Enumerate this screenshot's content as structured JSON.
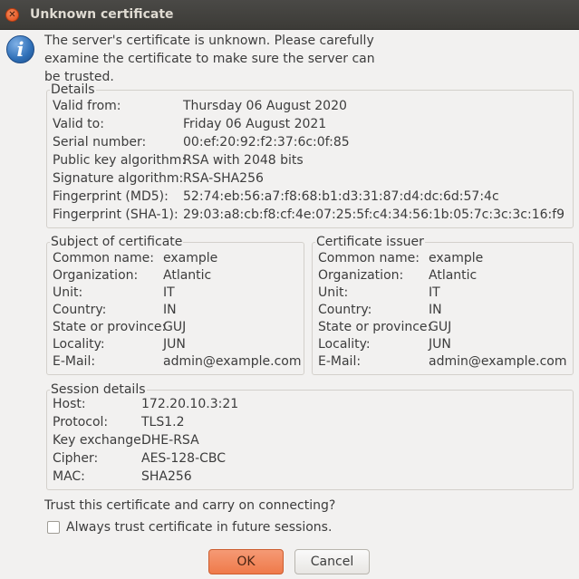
{
  "window": {
    "title": "Unknown certificate",
    "close_glyph": "✕"
  },
  "message": "The server's certificate is unknown. Please carefully examine the certificate to make sure the server can be trusted.",
  "details": {
    "label": "Details",
    "rows": [
      {
        "key": "Valid from:",
        "value": "Thursday 06 August 2020"
      },
      {
        "key": "Valid to:",
        "value": "Friday 06 August 2021"
      },
      {
        "key": "Serial number:",
        "value": "00:ef:20:92:f2:37:6c:0f:85"
      },
      {
        "key": "Public key algorithm:",
        "value": "RSA with 2048 bits"
      },
      {
        "key": "Signature algorithm:",
        "value": "RSA-SHA256"
      },
      {
        "key": "Fingerprint (MD5):",
        "value": "52:74:eb:56:a7:f8:68:b1:d3:31:87:d4:dc:6d:57:4c"
      },
      {
        "key": "Fingerprint (SHA-1):",
        "value": "29:03:a8:cb:f8:cf:4e:07:25:5f:c4:34:56:1b:05:7c:3c:3c:16:f9"
      }
    ]
  },
  "subject": {
    "label": "Subject of certificate",
    "rows": [
      {
        "key": "Common name:",
        "value": "example"
      },
      {
        "key": "Organization:",
        "value": "Atlantic"
      },
      {
        "key": "Unit:",
        "value": "IT"
      },
      {
        "key": "Country:",
        "value": "IN"
      },
      {
        "key": "State or province:",
        "value": "GUJ"
      },
      {
        "key": "Locality:",
        "value": "JUN"
      },
      {
        "key": "E-Mail:",
        "value": "admin@example.com"
      }
    ]
  },
  "issuer": {
    "label": "Certificate issuer",
    "rows": [
      {
        "key": "Common name:",
        "value": "example"
      },
      {
        "key": "Organization:",
        "value": "Atlantic"
      },
      {
        "key": "Unit:",
        "value": "IT"
      },
      {
        "key": "Country:",
        "value": "IN"
      },
      {
        "key": "State or province:",
        "value": "GUJ"
      },
      {
        "key": "Locality:",
        "value": "JUN"
      },
      {
        "key": "E-Mail:",
        "value": "admin@example.com"
      }
    ]
  },
  "session": {
    "label": "Session details",
    "rows": [
      {
        "key": "Host:",
        "value": "172.20.10.3:21"
      },
      {
        "key": "Protocol:",
        "value": "TLS1.2"
      },
      {
        "key": "Key exchange:",
        "value": "DHE-RSA"
      },
      {
        "key": "Cipher:",
        "value": "AES-128-CBC"
      },
      {
        "key": "MAC:",
        "value": "SHA256"
      }
    ]
  },
  "trust_question": "Trust this certificate and carry on connecting?",
  "always_trust": {
    "label": "Always trust certificate in future sessions.",
    "checked": false
  },
  "buttons": {
    "ok": "OK",
    "cancel": "Cancel"
  },
  "icons": {
    "info": "info-icon",
    "info_glyph": "i",
    "close": "close-icon"
  },
  "colors": {
    "titlebar": "#3c3b37",
    "title_text": "#dfdbd2",
    "close_button": "#df4a16",
    "ok_button": "#ef7a4a",
    "background": "#f2f1f0"
  }
}
